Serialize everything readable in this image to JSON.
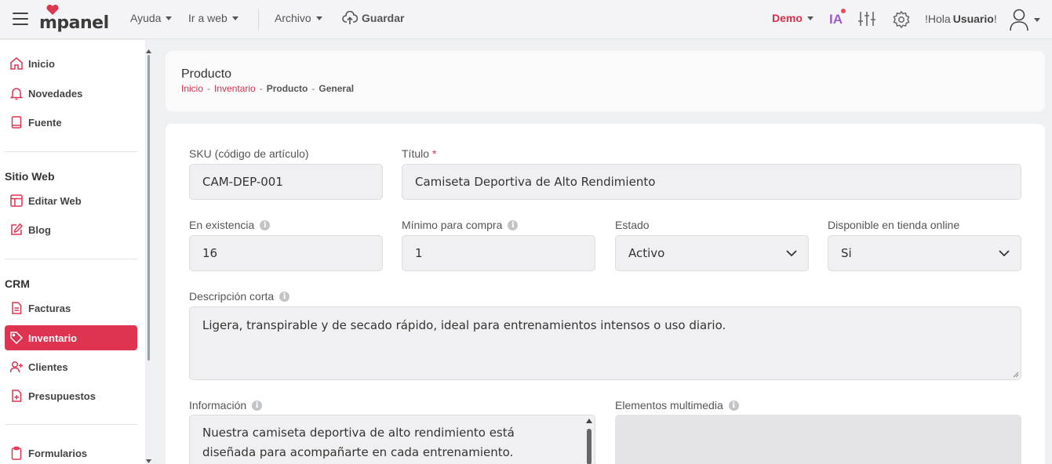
{
  "header": {
    "logo_text": "mpanel",
    "menu": [
      {
        "label": "Ayuda"
      },
      {
        "label": "Ir a web"
      },
      {
        "label": "Archivo"
      }
    ],
    "save_label": "Guardar",
    "account_label": "Demo",
    "ai_label": "IA",
    "greeting": "!Hola",
    "user_name": "Usuario",
    "greeting_end": "!",
    "accent_color": "#df3451"
  },
  "sidebar": {
    "items_top": [
      {
        "label": "Inicio",
        "icon": "home-icon"
      },
      {
        "label": "Novedades",
        "icon": "bell-icon"
      },
      {
        "label": "Fuente",
        "icon": "book-icon"
      }
    ],
    "section_web": "Sitio Web",
    "items_web": [
      {
        "label": "Editar Web",
        "icon": "layout-icon"
      },
      {
        "label": "Blog",
        "icon": "edit-icon"
      }
    ],
    "section_crm": "CRM",
    "items_crm": [
      {
        "label": "Facturas",
        "icon": "invoice-icon"
      },
      {
        "label": "Inventario",
        "icon": "tag-icon",
        "active": true
      },
      {
        "label": "Clientes",
        "icon": "user-plus-icon"
      },
      {
        "label": "Presupuestos",
        "icon": "file-plus-icon"
      }
    ],
    "items_bottom": [
      {
        "label": "Formularios",
        "icon": "clipboard-icon"
      }
    ]
  },
  "page": {
    "title": "Producto",
    "breadcrumb": [
      "Inicio",
      "Inventario",
      "Producto",
      "General"
    ]
  },
  "form": {
    "sku": {
      "label": "SKU (código de artículo)",
      "value": "CAM-DEP-001"
    },
    "titulo": {
      "label": "Título",
      "required": "*",
      "value": "Camiseta Deportiva de Alto Rendimiento"
    },
    "existencia": {
      "label": "En existencia",
      "value": "16"
    },
    "minimo": {
      "label": "Mínimo para compra",
      "value": "1"
    },
    "estado": {
      "label": "Estado",
      "value": "Activo"
    },
    "disponible": {
      "label": "Disponible en tienda online",
      "value": "Si"
    },
    "descripcion": {
      "label": "Descripción corta",
      "value": "Ligera, transpirable y de secado rápido, ideal para entrenamientos intensos o uso diario."
    },
    "informacion": {
      "label": "Información",
      "line1": "Nuestra camiseta deportiva de alto rendimiento está",
      "line2": "diseñada para acompañarte en cada entrenamiento."
    },
    "multimedia": {
      "label": "Elementos multimedia"
    }
  }
}
